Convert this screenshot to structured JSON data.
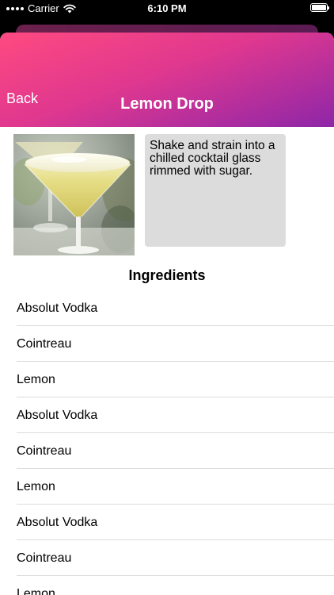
{
  "status_bar": {
    "carrier": "Carrier",
    "time": "6:10 PM"
  },
  "header": {
    "back_label": "Back",
    "title": "Lemon Drop"
  },
  "drink": {
    "instructions": "Shake and strain into a chilled cocktail glass rimmed with sugar."
  },
  "ingredients": {
    "title": "Ingredients",
    "items": [
      "Absolut Vodka",
      "Cointreau",
      "Lemon",
      "Absolut Vodka",
      "Cointreau",
      "Lemon",
      "Absolut Vodka",
      "Cointreau",
      "Lemon"
    ]
  },
  "colors": {
    "header_gradient_start": "#ff4a80",
    "header_gradient_end": "#8e26a8",
    "instructions_bg": "#dcdcdc"
  }
}
